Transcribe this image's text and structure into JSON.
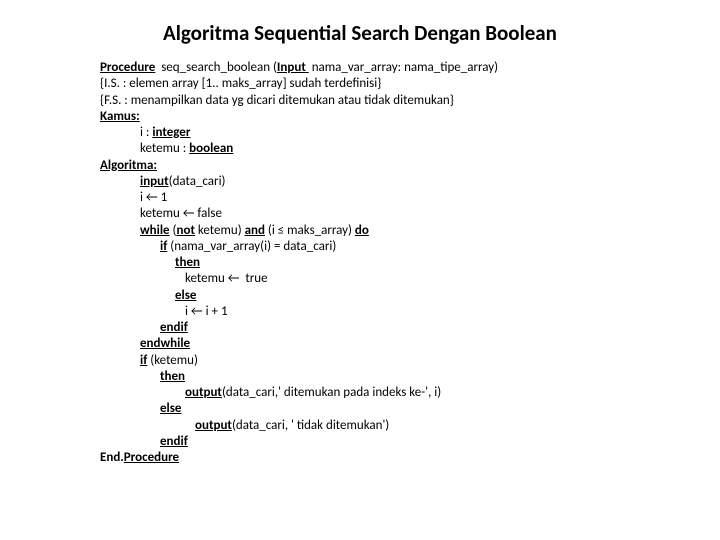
{
  "title": "Algoritma Sequential Search Dengan Boolean",
  "l1_a": "Procedure",
  "l1_b": "  seq_search_boolean (",
  "l1_c": "Input ",
  "l1_d": " nama_var_array: nama_tipe_array)",
  "l2": "{I.S. : elemen array [1.. maks_array] sudah terdefinisi}",
  "l3": "{F.S. : menampilkan data yg dicari ditemukan atau tidak ditemukan}",
  "l4": "Kamus:",
  "l5_a": "i : ",
  "l5_b": "integer",
  "l6_a": "ketemu : ",
  "l6_b": "boolean",
  "l7": "Algoritma:",
  "l8_a": "input",
  "l8_b": "(data_cari)",
  "l9": "i ← 1",
  "l10": "ketemu ← false",
  "l11_a": "while",
  "l11_b": " (",
  "l11_c": "not",
  "l11_d": " ketemu) ",
  "l11_e": "and",
  "l11_f": " (i ≤ maks_array) ",
  "l11_g": "do",
  "l12_a": "if",
  "l12_b": " (nama_var_array(i) = data_cari)",
  "l13": "then",
  "l14": "ketemu ←  true",
  "l15": "else",
  "l16": "i ← i + 1",
  "l17": "endif",
  "l18": "endwhile",
  "l19_a": "if",
  "l19_b": " (ketemu)",
  "l20": "then",
  "l21_a": "output",
  "l21_b": "(data_cari,' ditemukan pada indeks ke-', i)",
  "l22": "else",
  "l23_a": "output",
  "l23_b": "(data_cari, ' tidak ditemukan')",
  "l24": "endif",
  "l25_a": "End.",
  "l25_b": "Procedure"
}
